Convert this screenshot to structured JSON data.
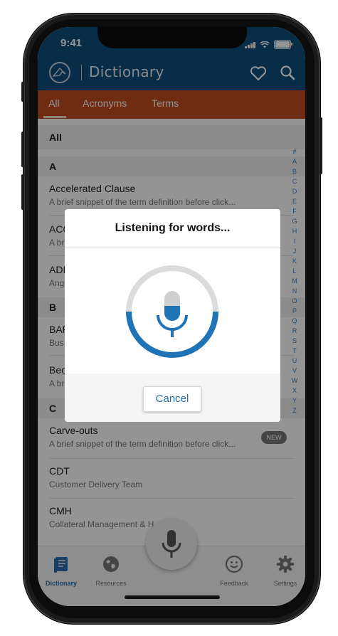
{
  "status": {
    "time": "9:41"
  },
  "header": {
    "title": "Dictionary"
  },
  "tabs": [
    {
      "label": "All"
    },
    {
      "label": "Acronyms"
    },
    {
      "label": "Terms"
    }
  ],
  "list": {
    "all_header": "All",
    "sections": [
      "A",
      "B",
      "C"
    ],
    "items": [
      {
        "title": "Accelerated Clause",
        "sub": "A brief snippet of the term definition before click..."
      },
      {
        "title": "ACC",
        "sub": "A bri"
      },
      {
        "title": "ADI",
        "sub": "Ang"
      },
      {
        "title": "BAR",
        "sub": "Bus"
      },
      {
        "title": "Bec",
        "sub": "A br"
      },
      {
        "title": "Carve-outs",
        "sub": "A brief snippet of the term definition before click..."
      },
      {
        "title": "CDT",
        "sub": "Customer Delivery Team"
      },
      {
        "title": "CMH",
        "sub": "Collateral Management & H"
      }
    ],
    "new_badge": "NEW",
    "index": [
      "#",
      "A",
      "B",
      "C",
      "D",
      "E",
      "F",
      "G",
      "H",
      "I",
      "J",
      "K",
      "L",
      "M",
      "N",
      "O",
      "P",
      "Q",
      "R",
      "S",
      "T",
      "U",
      "V",
      "W",
      "X",
      "Y",
      "Z"
    ]
  },
  "dialog": {
    "title": "Listening for words...",
    "cancel_label": "Cancel"
  },
  "bottom_nav": [
    {
      "label": "Dictionary",
      "icon": "book-icon",
      "active": true
    },
    {
      "label": "Resources",
      "icon": "globe-icon",
      "active": false
    },
    {
      "label": "Feedback",
      "icon": "smiley-icon",
      "active": false
    },
    {
      "label": "Settings",
      "icon": "gear-icon",
      "active": false
    }
  ],
  "colors": {
    "header": "#0d4f7c",
    "tabs": "#c14d1f",
    "accent": "#1f73b7",
    "active_nav": "#2a6fb0"
  }
}
